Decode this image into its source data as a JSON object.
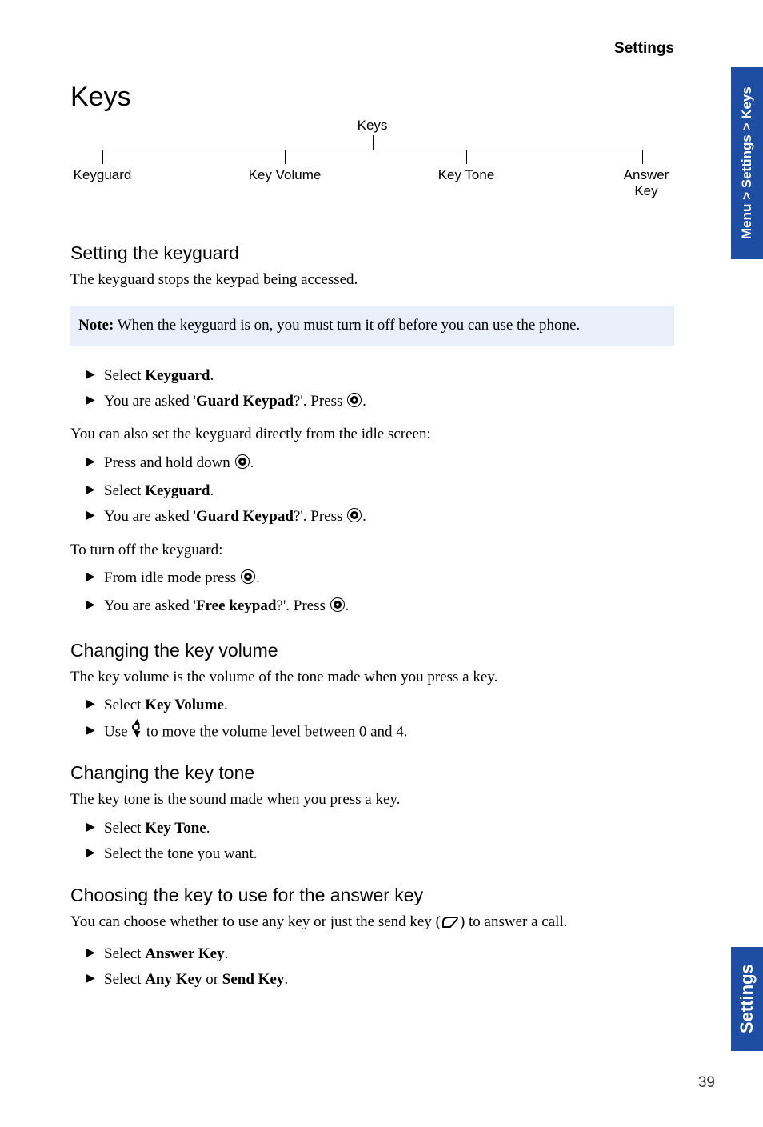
{
  "header": {
    "section": "Settings"
  },
  "title": "Keys",
  "tree": {
    "root": "Keys",
    "leaves": [
      "Keyguard",
      "Key Volume",
      "Key Tone",
      "Answer<br>Key"
    ]
  },
  "sections": {
    "keyguard": {
      "heading": "Setting the keyguard",
      "intro": "The keyguard stops the keypad being accessed.",
      "note_label": "Note:",
      "note_body": " When the keyguard is on, you must turn it off before you can use the phone.",
      "step1_a": "Select ",
      "step1_b": "Keyguard",
      "step1_c": ".",
      "step2_a": "You are asked '",
      "step2_b": "Guard Keypad",
      "step2_c": "?'. Press ",
      "step2_d": ".",
      "idle_intro": "You can also set the keyguard directly from the idle screen:",
      "step3_a": "Press and hold down ",
      "step3_b": ".",
      "step4_a": "Select ",
      "step4_b": "Keyguard",
      "step4_c": ".",
      "step5_a": "You are asked '",
      "step5_b": "Guard Keypad",
      "step5_c": "?'. Press ",
      "step5_d": ".",
      "off_intro": "To turn off the keyguard:",
      "step6_a": "From idle mode press ",
      "step6_b": ".",
      "step7_a": "You are asked '",
      "step7_b": "Free keypad",
      "step7_c": "?'. Press ",
      "step7_d": "."
    },
    "keyvolume": {
      "heading": "Changing the key volume",
      "intro": "The key volume is the volume of the tone made when you press a key.",
      "step1_a": "Select ",
      "step1_b": "Key Volume",
      "step1_c": ".",
      "step2_a": "Use ",
      "step2_b": " to move the volume level between 0 and 4."
    },
    "keytone": {
      "heading": "Changing the key tone",
      "intro": "The key tone is the sound made when you press a key.",
      "step1_a": "Select ",
      "step1_b": "Key Tone",
      "step1_c": ".",
      "step2": "Select the tone you want."
    },
    "answerkey": {
      "heading": "Choosing the key to use for the answer key",
      "intro_a": "You can choose whether to use any key or just the send key (",
      "intro_b": ") to answer a call.",
      "step1_a": "Select ",
      "step1_b": "Answer Key",
      "step1_c": ".",
      "step2_a": "Select ",
      "step2_b": "Any Key",
      "step2_c": " or ",
      "step2_d": "Send Key",
      "step2_e": "."
    }
  },
  "tabs": {
    "top": "Menu > Settings > Keys",
    "bottom": "Settings"
  },
  "page_number": "39"
}
